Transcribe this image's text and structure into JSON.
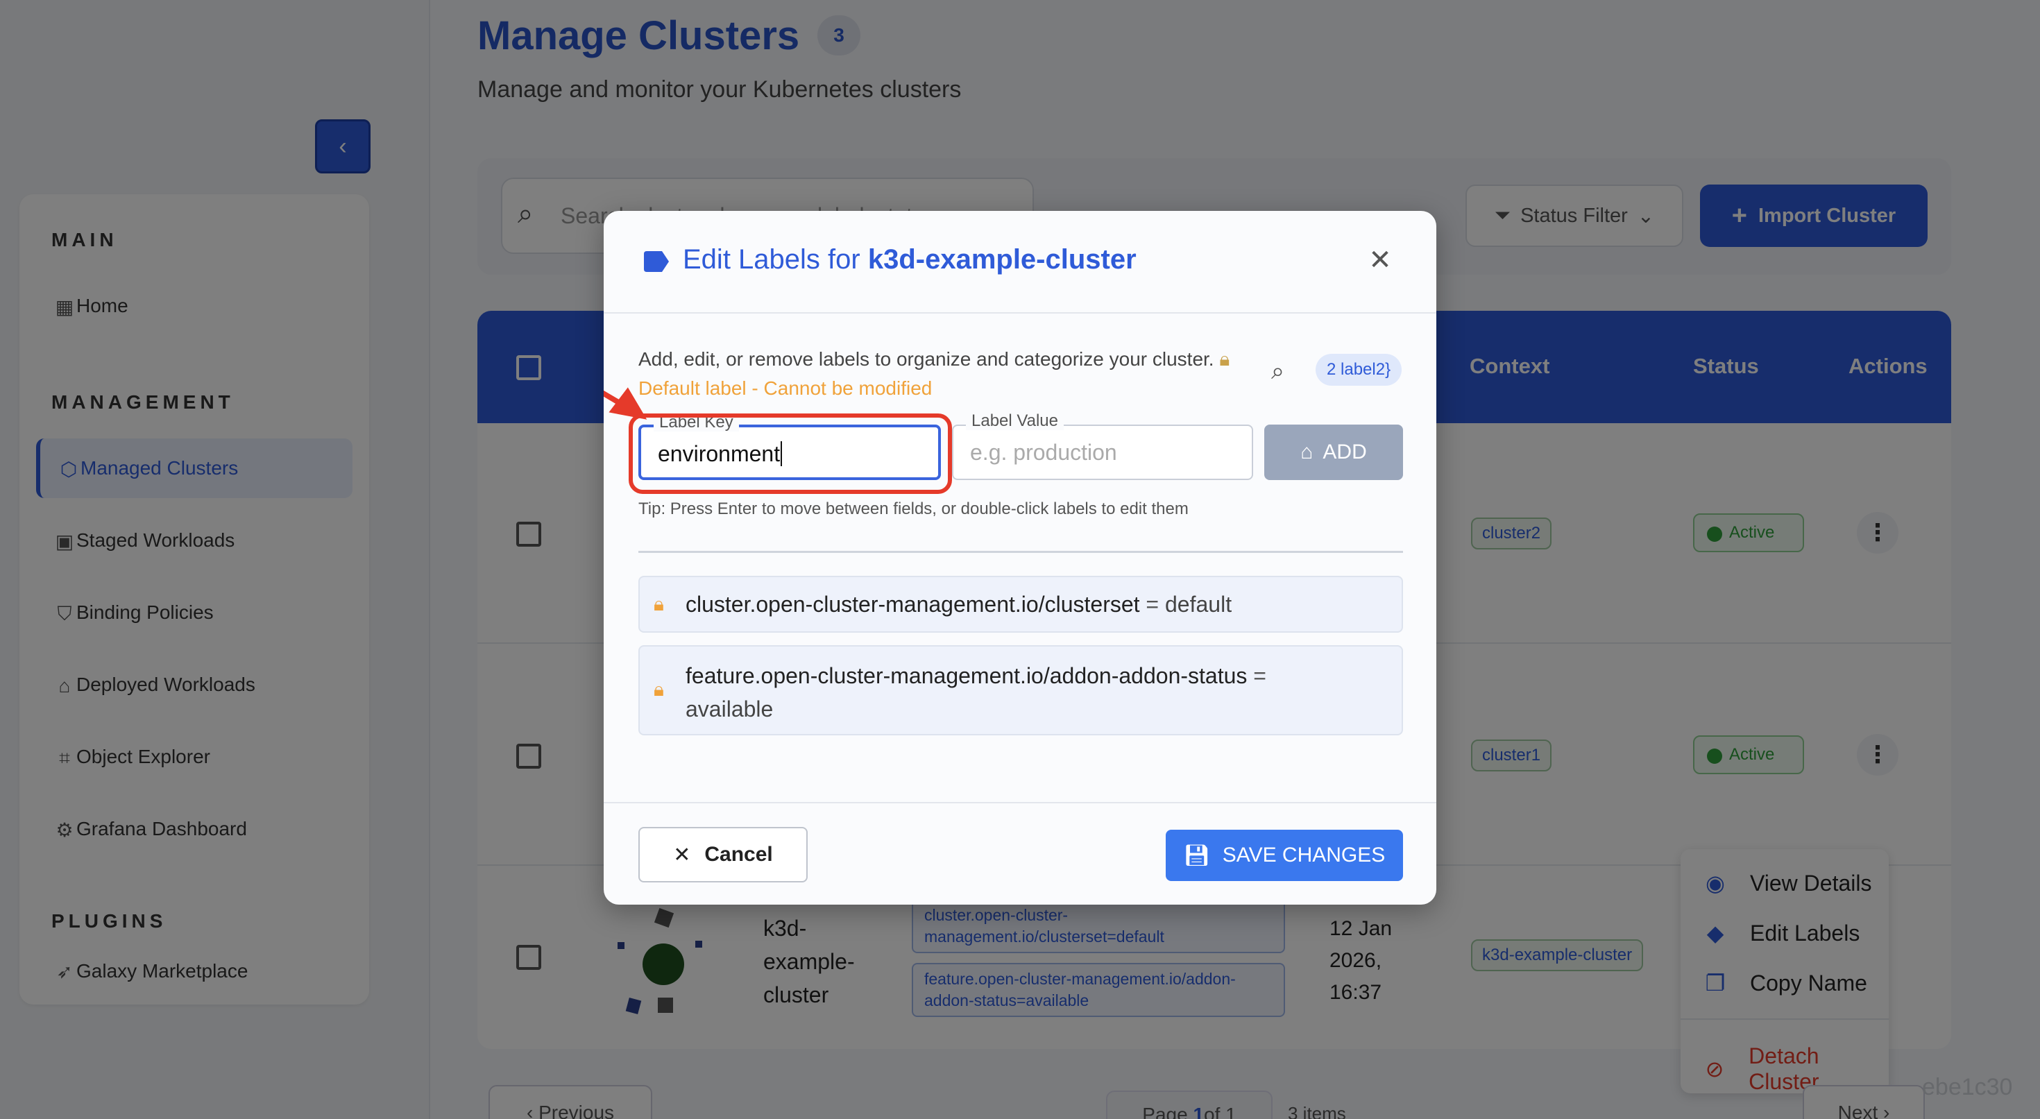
{
  "header": {
    "title": "Manage Clusters",
    "count": "3",
    "subtitle": "Manage and monitor your Kubernetes clusters"
  },
  "toolbar": {
    "search_placeholder": "Search clusters by name, label, status...",
    "status_filter": "Status Filter",
    "import_label": "Import Cluster"
  },
  "sidebar": {
    "sections": [
      {
        "title": "MAIN",
        "items": [
          {
            "label": "Home"
          }
        ]
      },
      {
        "title": "MANAGEMENT",
        "items": [
          {
            "label": "Managed Clusters",
            "active": true
          },
          {
            "label": "Staged Workloads"
          },
          {
            "label": "Binding Policies"
          },
          {
            "label": "Deployed Workloads"
          },
          {
            "label": "Object Explorer"
          },
          {
            "label": "Grafana Dashboard"
          }
        ]
      },
      {
        "title": "PLUGINS",
        "items": [
          {
            "label": "Galaxy Marketplace"
          }
        ]
      }
    ]
  },
  "table": {
    "columns": [
      "Context",
      "Status",
      "Actions"
    ],
    "rows": [
      {
        "context": "cluster2",
        "status": "Active"
      },
      {
        "context": "cluster1",
        "status": "Active"
      },
      {
        "name_l1": "k3d-",
        "name_l2": "example-",
        "name_l3": "cluster",
        "label1_l1": "cluster.open-cluster-",
        "label1_l2": "management.io/clusterset=default",
        "label2_l1": "feature.open-cluster-management.io/addon-",
        "label2_l2": "addon-status=available",
        "date_l1": "12 Jan",
        "date_l2": "2026,",
        "date_l3": "16:37",
        "context": "k3d-example-cluster"
      }
    ]
  },
  "context_menu": {
    "view": "View Details",
    "edit": "Edit Labels",
    "copy": "Copy Name",
    "detach": "Detach Cluster"
  },
  "pagination": {
    "previous": "Previous",
    "page_pre": "Page ",
    "page_num": "1",
    "page_post": "of 1",
    "items": "3 items",
    "next": "Next"
  },
  "watermark": "ebe1c30",
  "modal": {
    "title_prefix": "Edit Labels for ",
    "cluster_name": "k3d-example-cluster",
    "description": "Add, edit, or remove labels to organize and categorize your cluster.",
    "warning": "Default label - Cannot be modified",
    "count_badge": "2 label2}",
    "key_label": "Label Key",
    "key_value": "environment",
    "value_label": "Label Value",
    "value_placeholder": "e.g. production",
    "add_label": "ADD",
    "tip": "Tip: Press Enter to move between fields, or double-click labels to edit them",
    "labels": [
      {
        "key": "cluster.open-cluster-management.io/clusterset",
        "eq": " = ",
        "value": "default"
      },
      {
        "key": "feature.open-cluster-management.io/addon-addon-status",
        "eq": " =",
        "value": "available"
      }
    ],
    "cancel_label": "Cancel",
    "save_label": "SAVE CHANGES"
  },
  "colors": {
    "primary": "#2f5bd8",
    "warning": "#f0a23a",
    "danger": "#e53a2a",
    "success": "#2e9e3a"
  }
}
